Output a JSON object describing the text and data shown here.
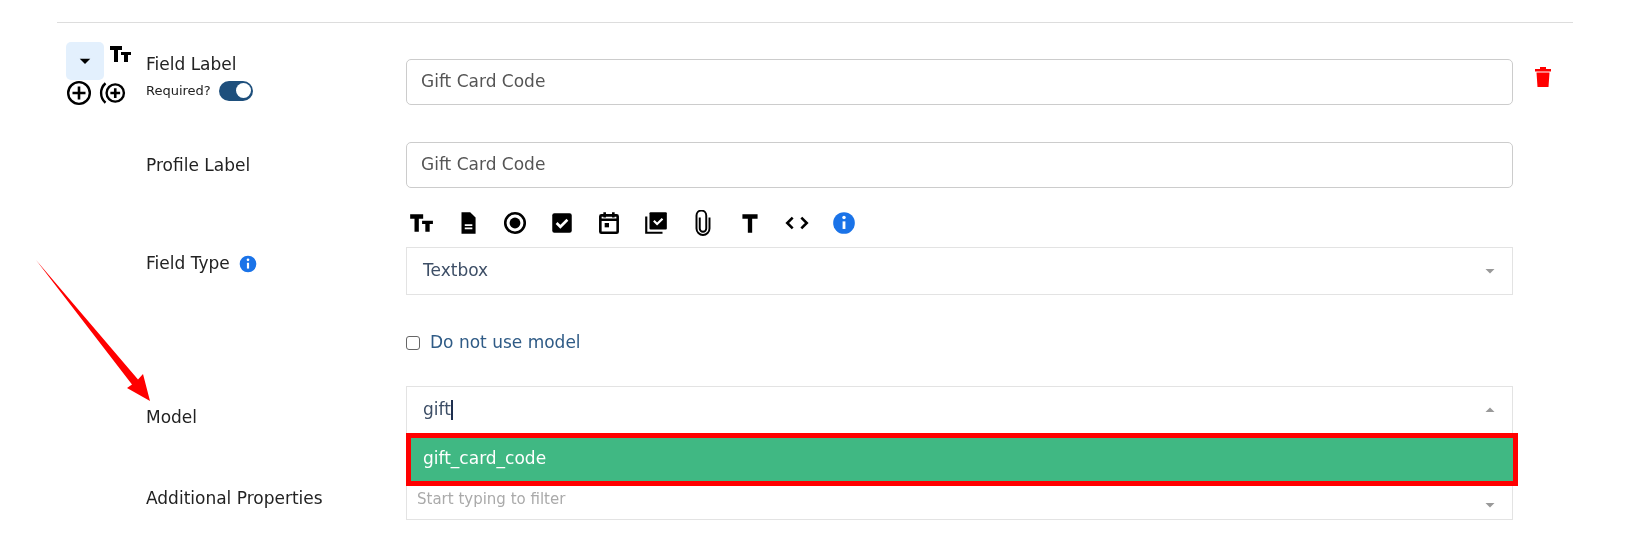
{
  "field_label": {
    "label": "Field Label",
    "value": "Gift Card Code",
    "required_label": "Required?",
    "required": true,
    "expanded": false
  },
  "profile_label": {
    "label": "Profile Label",
    "value": "Gift Card Code"
  },
  "field_type": {
    "label": "Field Type",
    "value": "Textbox",
    "types": [
      {
        "kind": "textbox"
      },
      {
        "kind": "document"
      },
      {
        "kind": "radio"
      },
      {
        "kind": "checkbox"
      },
      {
        "kind": "date"
      },
      {
        "kind": "multi-check"
      },
      {
        "kind": "file"
      },
      {
        "kind": "text"
      },
      {
        "kind": "html"
      },
      {
        "kind": "info"
      }
    ]
  },
  "no_model": {
    "label": "Do not use model",
    "checked": false
  },
  "model": {
    "label": "Model",
    "value": "gift",
    "expanded": true,
    "options": [
      {
        "label": "gift_card_code",
        "selected": true
      }
    ]
  },
  "additional_properties": {
    "label": "Additional Properties",
    "placeholder": "Start typing to filter"
  }
}
